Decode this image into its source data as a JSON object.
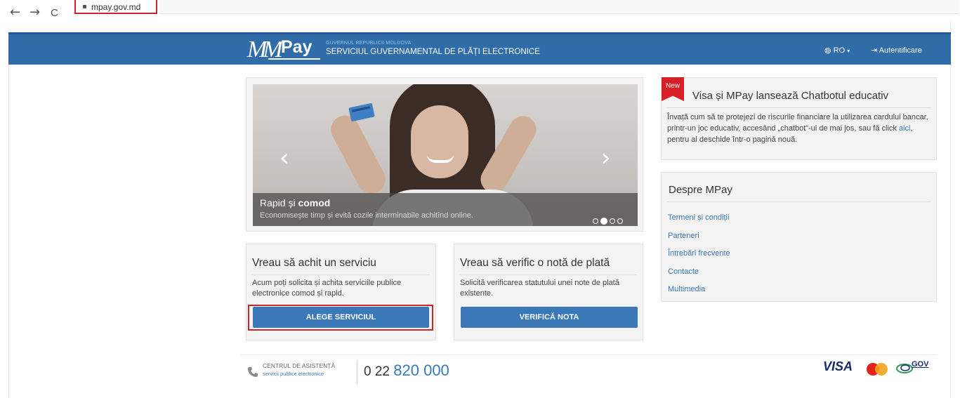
{
  "browser": {
    "back": "←",
    "forward": "→",
    "reload": "C",
    "url": "mpay.gov.md"
  },
  "header": {
    "logo_m": "MM",
    "logo_pay": "Pay",
    "gov_small": "GUVERNUL REPUBLICII MOLDOVA",
    "service_title": "SERVICIUL GUVERNAMENTAL DE PLĂȚI ELECTRONICE",
    "lang": "RO",
    "login": "Autentificare"
  },
  "carousel": {
    "prev": "‹",
    "next": "›",
    "caption_title_a": "Rapid și ",
    "caption_title_b": "comod",
    "caption_text": "Economisește timp și evită cozile interminabile achitînd online.",
    "slide_count": 4,
    "active_slide": 2
  },
  "actions": {
    "pay": {
      "title": "Vreau să achit un serviciu",
      "text": "Acum poți solicita și achita serviciile publice electronice comod și rapid.",
      "button": "ALEGE SERVICIUL"
    },
    "verify": {
      "title": "Vreau să verific o notă de plată",
      "text": "Solicită verificarea statutului unei note de plată existente.",
      "button": "VERIFICĂ NOTA"
    }
  },
  "news": {
    "badge": "New",
    "title": "Visa și MPay lansează Chatbotul educativ",
    "text_before": "Învață cum să te protejezi de riscurile financiare la utilizarea cardului bancar, printr-un joc educativ, accesând „chatbot”-ul de mai jos, sau fă click ",
    "link": "aici",
    "text_after": ", pentru al deschide într-o pagină nouă."
  },
  "about": {
    "title": "Despre MPay",
    "links": [
      "Termeni și condiții",
      "Parteneri",
      "Întrebări frecvente",
      "Contacte",
      "Multimedia"
    ]
  },
  "footer": {
    "assist_title": "CENTRUL DE ASISTENȚĂ",
    "assist_sub": "servicii publice electronice",
    "phone_prefix": "0 22 ",
    "phone_main": "820 000",
    "visa": "VISA",
    "mgov": "GOV"
  },
  "colors": {
    "header_blue": "#2f6ca8",
    "button_blue": "#3a78b8",
    "highlight_red": "#c8282d",
    "new_badge_red": "#d81f26"
  }
}
